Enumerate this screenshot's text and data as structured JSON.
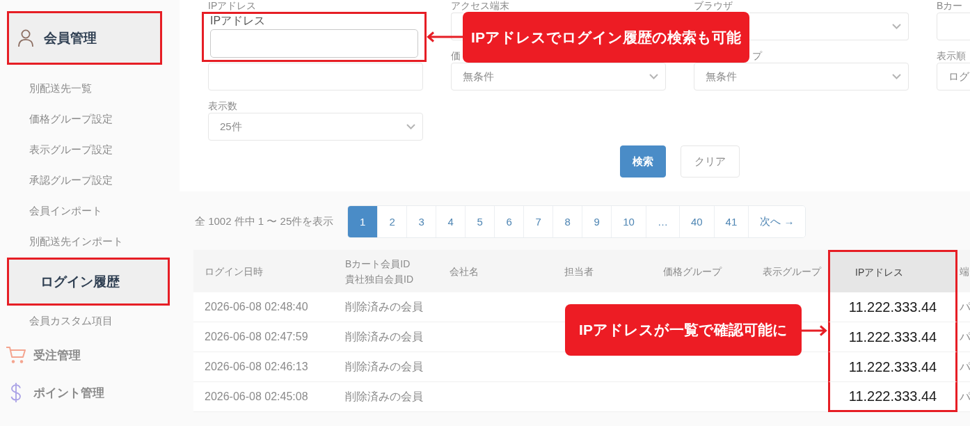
{
  "sidebar": {
    "sections": [
      {
        "label": "会員管理",
        "highlighted": true,
        "children": [
          {
            "label": "別配送先一覧",
            "highlighted": false
          },
          {
            "label": "価格グループ設定",
            "highlighted": false
          },
          {
            "label": "表示グループ設定",
            "highlighted": false
          },
          {
            "label": "承認グループ設定",
            "highlighted": false
          },
          {
            "label": "会員インポート",
            "highlighted": false
          },
          {
            "label": "別配送先インポート",
            "highlighted": false
          },
          {
            "label": "ログイン履歴",
            "highlighted": true
          },
          {
            "label": "会員カスタム項目",
            "highlighted": false
          }
        ]
      },
      {
        "label": "受注管理",
        "highlighted": false
      },
      {
        "label": "ポイント管理",
        "highlighted": false
      }
    ]
  },
  "search_form": {
    "fields": [
      {
        "label": "IPアドレス",
        "kind": "text",
        "highlight": {
          "label": "IPアドレス"
        }
      },
      {
        "label": "アクセス端末",
        "kind": "text"
      },
      {
        "label": "ブラウザ",
        "kind": "select"
      },
      {
        "label": "Bカー",
        "kind": "text"
      },
      {
        "kind": "text"
      },
      {
        "label": "価",
        "kind": "select",
        "value": "無条件"
      },
      {
        "label": "プ",
        "kind": "select",
        "value": "無条件"
      },
      {
        "label": "表示順",
        "kind": "select",
        "value": "ログ"
      },
      {
        "label": "表示数",
        "kind": "select",
        "value": "25件"
      }
    ],
    "buttons": [
      {
        "label": "検索",
        "kind": "primary"
      },
      {
        "label": "クリア",
        "kind": "secondary"
      }
    ]
  },
  "pagination": {
    "summary": "全 1002 件中 1 〜 25件を表示",
    "pages": [
      {
        "label": "1",
        "selected": true
      },
      {
        "label": "2",
        "selected": false
      },
      {
        "label": "3",
        "selected": false
      },
      {
        "label": "4",
        "selected": false
      },
      {
        "label": "5",
        "selected": false
      },
      {
        "label": "6",
        "selected": false
      },
      {
        "label": "7",
        "selected": false
      },
      {
        "label": "8",
        "selected": false
      },
      {
        "label": "9",
        "selected": false
      },
      {
        "label": "10",
        "selected": false
      },
      {
        "label": "…",
        "selected": false
      },
      {
        "label": "40",
        "selected": false
      },
      {
        "label": "41",
        "selected": false
      },
      {
        "label": "次へ →",
        "selected": false
      }
    ]
  },
  "table": {
    "columns": [
      {
        "label": "ログイン日時",
        "highlighted": false
      },
      {
        "label": "Bカート会員ID",
        "sublabel": "貴社独自会員ID",
        "highlighted": false
      },
      {
        "label": "会社名",
        "highlighted": false
      },
      {
        "label": "担当者",
        "highlighted": false
      },
      {
        "label": "価格グループ",
        "highlighted": false
      },
      {
        "label": "表示グループ",
        "highlighted": false
      },
      {
        "label": "IPアドレス",
        "highlighted": true
      },
      {
        "label": "端",
        "highlighted": false
      }
    ],
    "rows": [
      {
        "login_datetime": "2026-06-08 02:48:40",
        "member": "削除済みの会員",
        "ip_address": "11.222.333.44",
        "column_8": "パ"
      },
      {
        "login_datetime": "2026-06-08 02:47:59",
        "member": "削除済みの会員",
        "ip_address": "11.222.333.44",
        "column_8": "パ"
      },
      {
        "login_datetime": "2026-06-08 02:46:13",
        "member": "削除済みの会員",
        "ip_address": "11.222.333.44",
        "column_8": "パ"
      },
      {
        "login_datetime": "2026-06-08 02:45:08",
        "member": "削除済みの会員",
        "ip_address": "11.222.333.44",
        "column_8": "パ"
      }
    ]
  },
  "callouts": [
    {
      "text": "IPアドレスでログイン履歴の検索も可能",
      "kind": "left"
    },
    {
      "text": "IPアドレスが一覧で確認可能に",
      "kind": "right"
    }
  ]
}
